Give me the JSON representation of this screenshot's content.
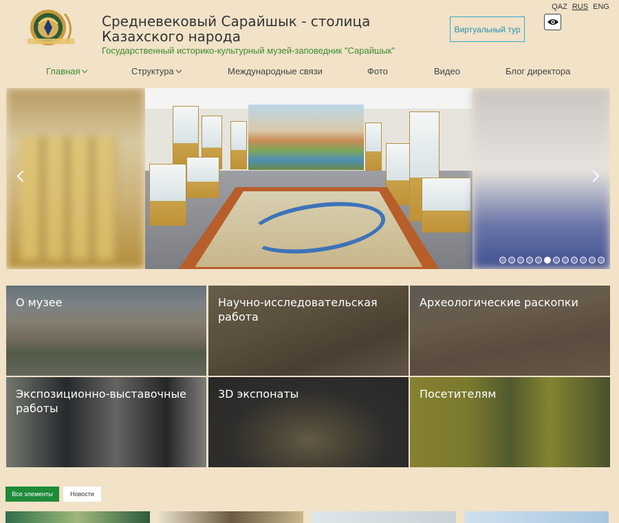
{
  "header": {
    "title": "Средневековый Сарайшык - столица Казахского народа",
    "subtitle": "Государственный историко-культурный музей-заповедник \"Сарайшык\"",
    "tour_button": "Виртуальный тур",
    "languages": [
      "QAZ",
      "RUS",
      "ENG"
    ],
    "active_language": "RUS"
  },
  "nav": {
    "items": [
      {
        "label": "Главная",
        "dropdown": true,
        "active": true
      },
      {
        "label": "Структура",
        "dropdown": true,
        "active": false
      },
      {
        "label": "Международные связи",
        "dropdown": false,
        "active": false
      },
      {
        "label": "Фото",
        "dropdown": false,
        "active": false
      },
      {
        "label": "Видео",
        "dropdown": false,
        "active": false
      },
      {
        "label": "Блог директора",
        "dropdown": false,
        "active": false
      }
    ]
  },
  "slider": {
    "slide_count": 12,
    "active_slide": 5
  },
  "tiles": [
    {
      "label": "О музее"
    },
    {
      "label": "Научно-исследовательская работа"
    },
    {
      "label": "Археологические раскопки"
    },
    {
      "label": "Экспозиционно-выставочные работы"
    },
    {
      "label": "3D экспонаты"
    },
    {
      "label": "Посетителям"
    }
  ],
  "filters": {
    "all": "Все элементы",
    "news": "Новости"
  },
  "colors": {
    "background": "#f1e2c8",
    "accent_green": "#3c8c2e",
    "button_green": "#1f8a3a",
    "tour_blue": "#39a7c9"
  },
  "icons": {
    "eye": "eye-icon",
    "logo": "museum-emblem-logo"
  }
}
